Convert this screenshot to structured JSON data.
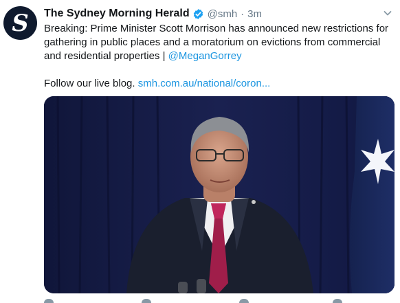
{
  "tweet": {
    "author": {
      "display_name": "The Sydney Morning Herald",
      "handle": "@smh",
      "verified_icon": "verified-badge-icon",
      "avatar_letter": "S"
    },
    "separator": "·",
    "timestamp": "3m",
    "text": {
      "line_main": "Breaking: Prime Minister Scott Morrison has announced new restrictions for gathering in public places and a moratorium on evictions from commercial and residential properties | ",
      "mention": "@MeganGorrey",
      "follow_text": "Follow our live blog. ",
      "blog_link": "smh.com.au/national/coron..."
    },
    "media": {
      "kind": "photo",
      "icon": "press-conference-photo"
    },
    "menu_icon": "chevron-down-icon",
    "colors": {
      "link": "#1b95e0",
      "muted": "#657786",
      "verified": "#1da1f2",
      "avatar_bg": "#0f1a2e"
    }
  }
}
